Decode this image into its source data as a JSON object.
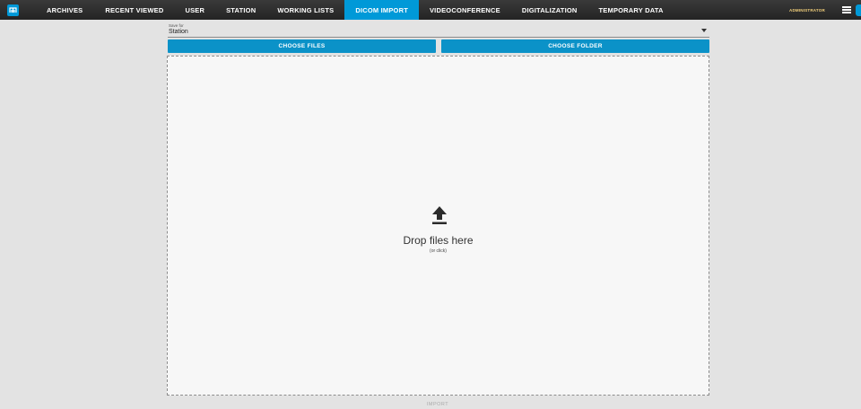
{
  "topbar": {
    "logo_icon": "app-logo-icon",
    "accent_color": "#0099d8",
    "tabs": [
      {
        "label": "ARCHIVES"
      },
      {
        "label": "RECENT VIEWED"
      },
      {
        "label": "USER"
      },
      {
        "label": "STATION"
      },
      {
        "label": "WORKING LISTS"
      },
      {
        "label": "DICOM IMPORT",
        "active": true
      },
      {
        "label": "VIDEOCONFERENCE"
      },
      {
        "label": "DIGITALIZATION"
      },
      {
        "label": "TEMPORARY DATA"
      }
    ],
    "user": "ADMINISTRATOR",
    "menu_icon": "hamburger-menu-icon"
  },
  "save_for": {
    "label": "Save for",
    "value": "Station"
  },
  "buttons": {
    "choose_files": "CHOOSE FILES",
    "choose_folder": "CHOOSE FOLDER"
  },
  "dropzone": {
    "icon": "upload-icon",
    "title": "Drop files here",
    "subtitle": "(or click)"
  },
  "footer": {
    "import_label": "IMPORT"
  }
}
